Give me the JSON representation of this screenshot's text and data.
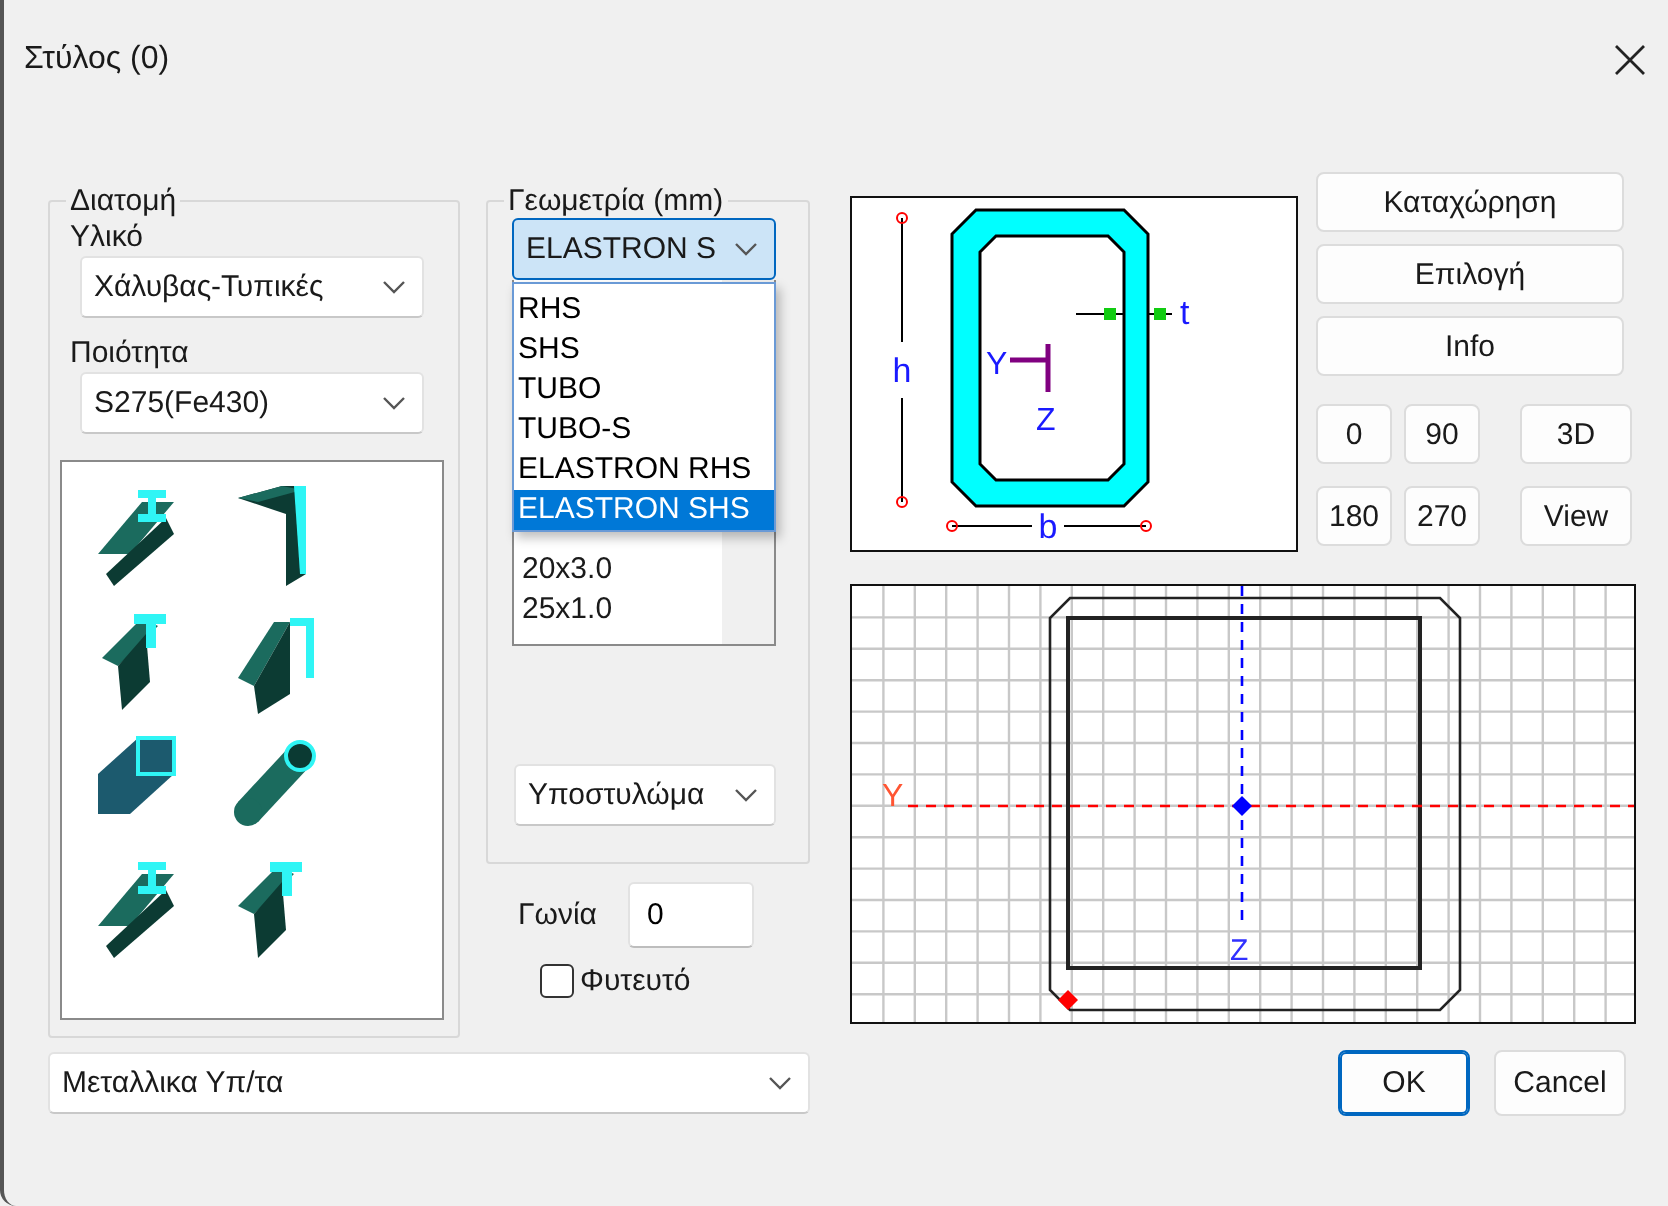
{
  "window": {
    "title": "Στύλος (0)"
  },
  "section_group": {
    "title": "Διατομή",
    "material_label": "Υλικό",
    "material": "Χάλυβας-Τυπικές",
    "quality_label": "Ποιότητα",
    "quality": "S275(Fe430)",
    "shapes": [
      {
        "kind": "i_beam"
      },
      {
        "kind": "angle"
      },
      {
        "kind": "tee"
      },
      {
        "kind": "channel"
      },
      {
        "kind": "square_tube"
      },
      {
        "kind": "round_tube"
      },
      {
        "kind": "i_beam"
      },
      {
        "kind": "tee"
      }
    ]
  },
  "geometry_group": {
    "title": "Γεωμετρία (mm)",
    "series": "ELASTRON S",
    "series_options": [
      {
        "label": "RHS",
        "selected": false
      },
      {
        "label": "SHS",
        "selected": false
      },
      {
        "label": "TUBO",
        "selected": false
      },
      {
        "label": "TUBO-S",
        "selected": false
      },
      {
        "label": "ELASTRON RHS",
        "selected": false
      },
      {
        "label": "ELASTRON SHS",
        "selected": true
      }
    ],
    "sizes": [
      "20x3.0",
      "25x1.0"
    ],
    "element_type": "Υποστυλώμα"
  },
  "angle": {
    "label": "Γωνία",
    "value": "0"
  },
  "embedded": {
    "label": "Φυτευτό",
    "checked": false
  },
  "category": "Μεταλλικα Υπ/τα",
  "section_drawing": {
    "dimension_labels": [
      "h",
      "b",
      "t"
    ],
    "axis_labels": [
      "Y",
      "Z"
    ]
  },
  "actions": [
    "Καταχώρηση",
    "Επιλογή",
    "Info"
  ],
  "rotation_buttons": [
    "0",
    "90",
    "180",
    "270"
  ],
  "view_buttons": [
    "3D",
    "View"
  ],
  "plan_view": {
    "axis_labels": [
      "Y",
      "Z"
    ]
  },
  "dialog_buttons": [
    {
      "label": "OK",
      "default": true
    },
    {
      "label": "Cancel",
      "default": false
    }
  ]
}
